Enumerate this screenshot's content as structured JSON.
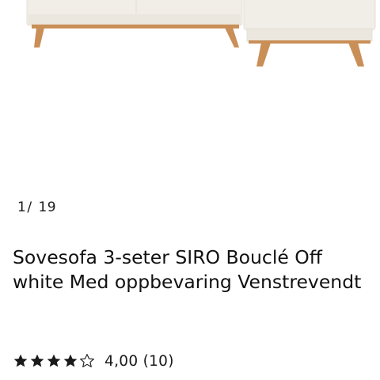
{
  "gallery": {
    "current": "1",
    "separator": "/",
    "total": "19"
  },
  "product": {
    "title": "Sovesofa 3-seter SIRO Bouclé Off white Med oppbevaring Venstrevendt"
  },
  "rating": {
    "value": 4.0,
    "max": 5,
    "text": "4,00 (10)",
    "star_color": "#1a1a1a"
  },
  "colors": {
    "fabric": "#f1eee7",
    "wood": "#c98f57"
  }
}
